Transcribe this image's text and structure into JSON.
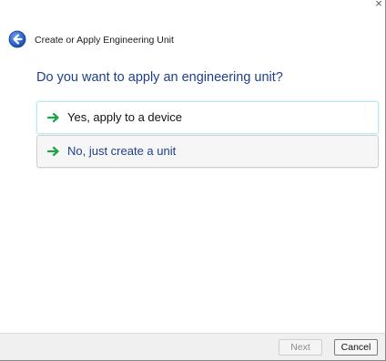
{
  "window": {
    "close_glyph": "×",
    "title": "Create or Apply Engineering Unit"
  },
  "back_icon": "back-arrow-circle-icon",
  "question": "Do you want to apply an engineering unit?",
  "options": [
    {
      "label": "Yes, apply to a device",
      "icon": "green-arrow-icon"
    },
    {
      "label": "No, just create a unit",
      "icon": "green-arrow-icon"
    }
  ],
  "footer": {
    "next_label": "Next",
    "cancel_label": "Cancel"
  },
  "colors": {
    "question_text": "#1f3f8c",
    "arrow_green": "#1ea34a",
    "back_button_blue": "#2a5fc4"
  }
}
